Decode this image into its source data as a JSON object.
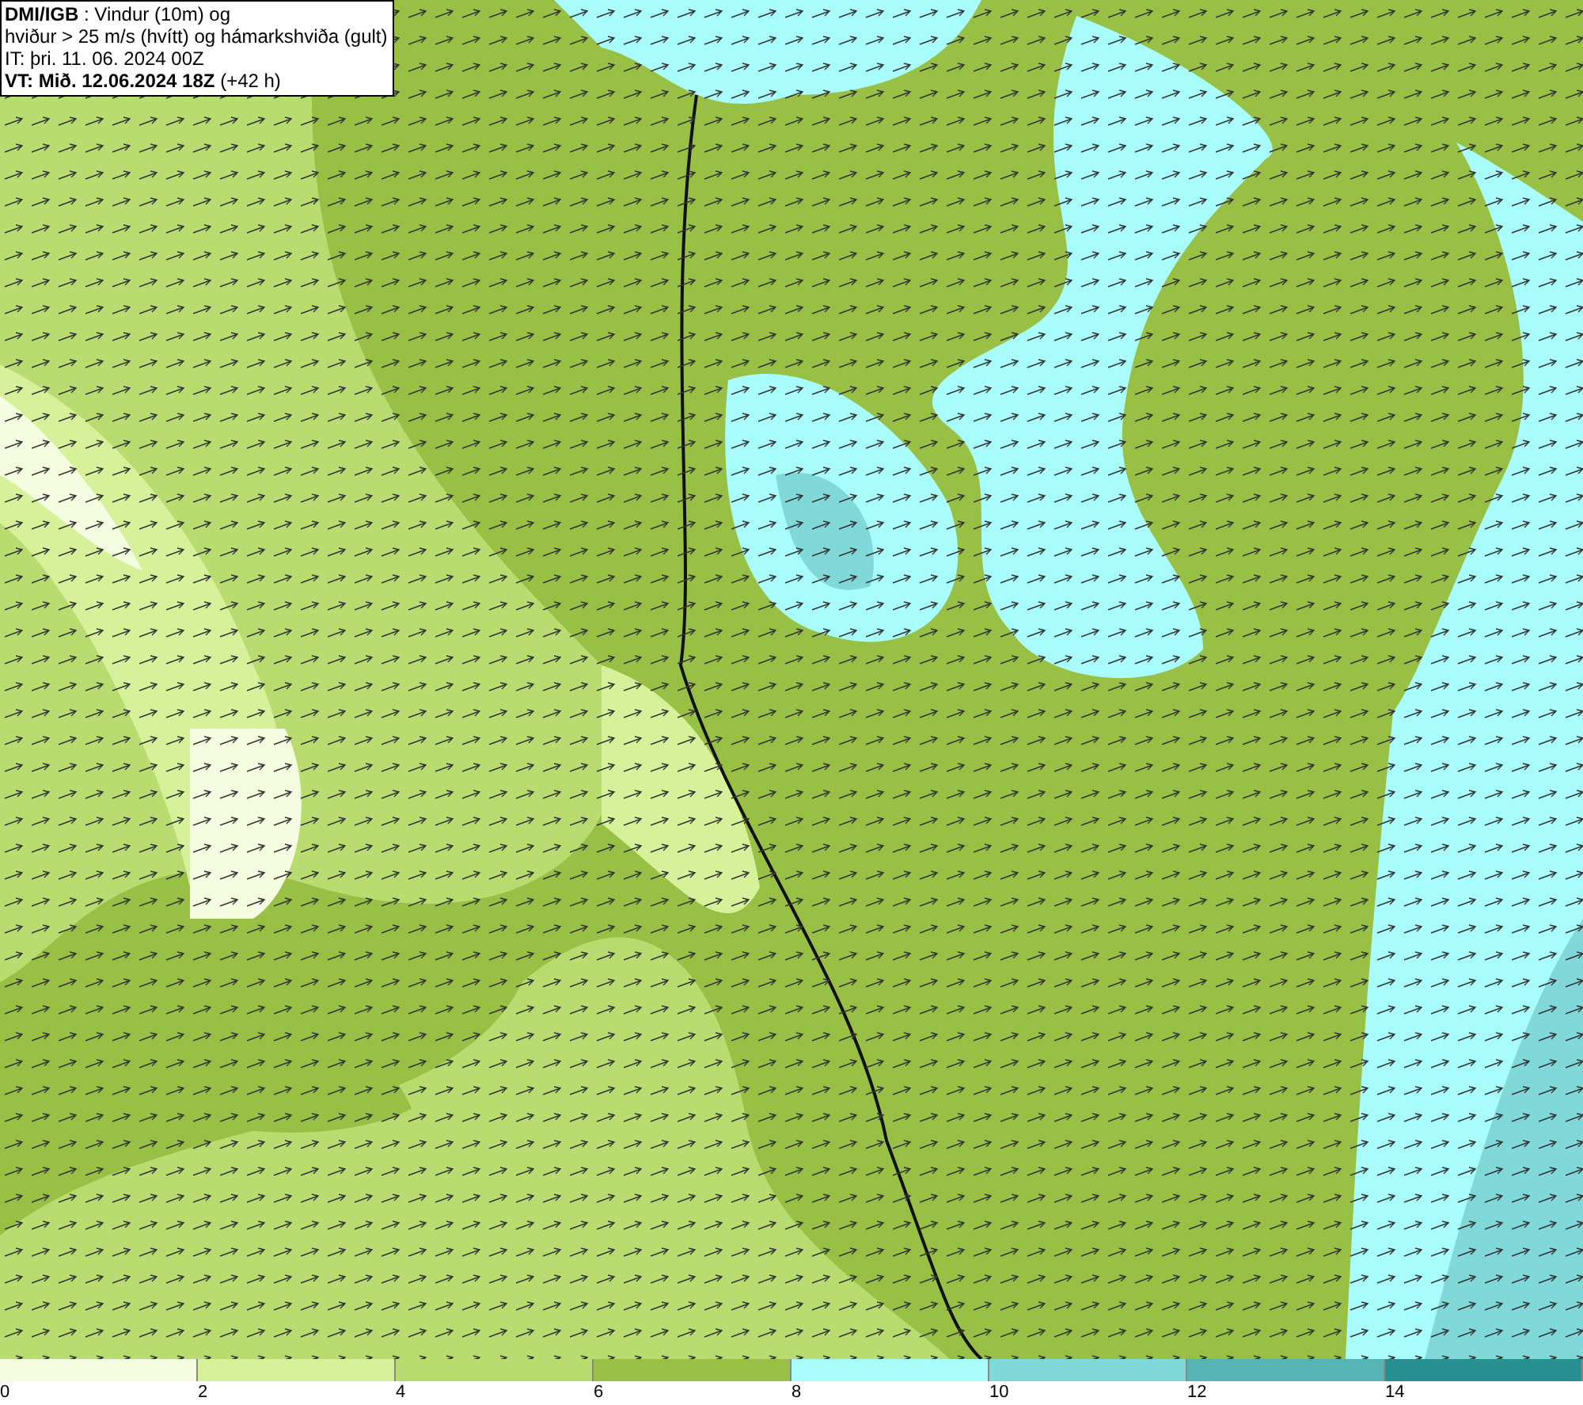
{
  "header": {
    "lines": [
      "**DMI/IGB** : Vindur (10m) og",
      "hviður > 25 m/s (hvítt) og hámarkshviða (gult)",
      "IT: þri. 11. 06. 2024 00Z",
      "**VT: Mið. 12.06.2024 18Z** (+42 h)"
    ]
  },
  "legend": {
    "bins": [
      {
        "label": "0",
        "color": "#f5fde0"
      },
      {
        "label": "2",
        "color": "#d7f09a"
      },
      {
        "label": "4",
        "color": "#b8dc70"
      },
      {
        "label": "6",
        "color": "#98c044"
      },
      {
        "label": "8",
        "color": "#a8fcfc"
      },
      {
        "label": "10",
        "color": "#80d8d8"
      },
      {
        "label": "12",
        "color": "#56b4b4"
      },
      {
        "label": "14",
        "color": "#289090"
      }
    ]
  }
}
